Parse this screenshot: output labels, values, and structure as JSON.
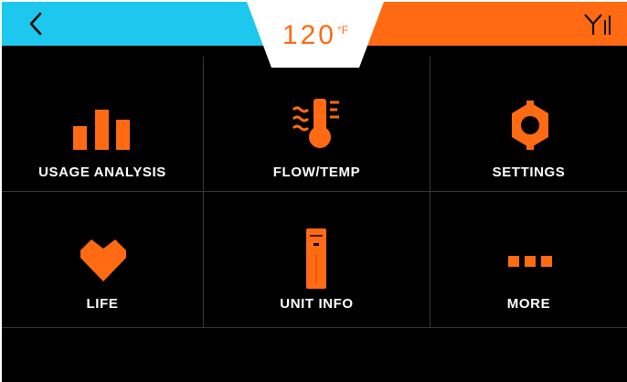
{
  "header": {
    "back_icon": "chevron-left-icon",
    "temperature_value": "120",
    "temperature_unit": "°F",
    "signal_icon": "signal-icon",
    "colors": {
      "left": "#1cc8ee",
      "right": "#ff6a13",
      "center": "#ffffff",
      "accent": "#ff6a13"
    }
  },
  "menu": {
    "items": [
      {
        "label": "USAGE ANALYSIS",
        "icon": "bar-chart-icon"
      },
      {
        "label": "FLOW/TEMP",
        "icon": "thermometer-flow-icon"
      },
      {
        "label": "SETTINGS",
        "icon": "gear-icon"
      },
      {
        "label": "LIFE",
        "icon": "heart-icon"
      },
      {
        "label": "UNIT INFO",
        "icon": "unit-icon"
      },
      {
        "label": "MORE",
        "icon": "more-icon"
      }
    ]
  }
}
